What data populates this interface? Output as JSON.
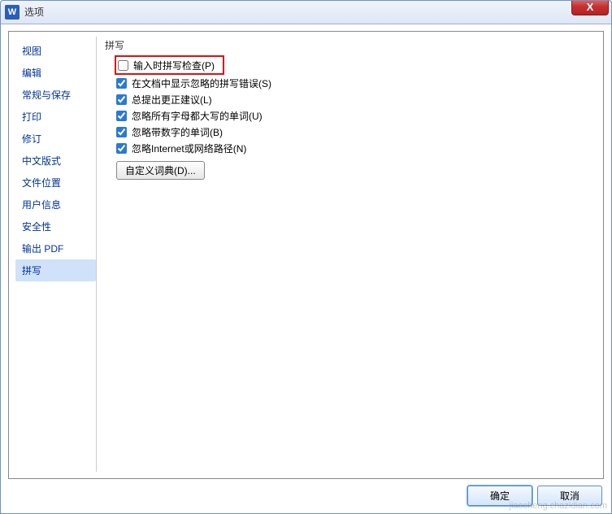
{
  "window": {
    "icon_letter": "W",
    "title": "选项",
    "close_glyph": "X"
  },
  "sidebar": {
    "items": [
      {
        "label": "视图"
      },
      {
        "label": "编辑"
      },
      {
        "label": "常规与保存"
      },
      {
        "label": "打印"
      },
      {
        "label": "修订"
      },
      {
        "label": "中文版式"
      },
      {
        "label": "文件位置"
      },
      {
        "label": "用户信息"
      },
      {
        "label": "安全性"
      },
      {
        "label": "输出 PDF"
      },
      {
        "label": "拼写"
      }
    ]
  },
  "panel": {
    "section_title": "拼写",
    "checks": [
      {
        "label": "输入时拼写检查(P)",
        "checked": false
      },
      {
        "label": "在文档中显示忽略的拼写错误(S)",
        "checked": true
      },
      {
        "label": "总提出更正建议(L)",
        "checked": true
      },
      {
        "label": "忽略所有字母都大写的单词(U)",
        "checked": true
      },
      {
        "label": "忽略带数字的单词(B)",
        "checked": true
      },
      {
        "label": "忽略Internet或网络路径(N)",
        "checked": true
      }
    ],
    "custom_dict_label": "自定义词典(D)..."
  },
  "footer": {
    "ok_label": "确定",
    "cancel_label": "取消"
  },
  "watermark": "jiaocheng.chazidian.com"
}
